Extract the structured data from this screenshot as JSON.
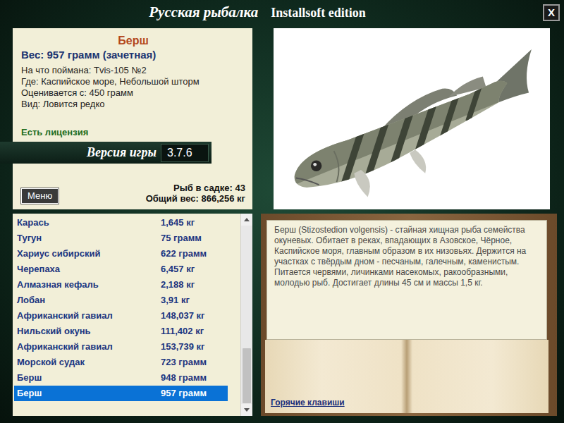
{
  "window": {
    "title": "Русская рыбалка",
    "subtitle": "Installsoft edition",
    "close": "X"
  },
  "catch": {
    "name": "Берш",
    "weight": "Вес: 957 грамм (зачетная)",
    "details": [
      "На что поймана: Tvis-105 №2",
      "Где: Каспийское море, Небольшой шторм",
      "Оценивается с: 450 грамм",
      "Вид: Ловится редко"
    ],
    "license": "Есть лицензия"
  },
  "version": {
    "label": "Версия игры",
    "value": "3.7.6"
  },
  "menu_button": "Меню",
  "keepnet": {
    "count": "Рыб в садке: 43",
    "total": "Общий вес: 866,256 кг"
  },
  "list": {
    "rows": [
      {
        "name": "Карась",
        "weight": "1,645 кг",
        "selected": false
      },
      {
        "name": "Тугун",
        "weight": "75 грамм",
        "selected": false
      },
      {
        "name": "Хариус сибирский",
        "weight": "622 грамм",
        "selected": false
      },
      {
        "name": "Черепаха",
        "weight": "6,457 кг",
        "selected": false
      },
      {
        "name": "Алмазная кефаль",
        "weight": "2,188 кг",
        "selected": false
      },
      {
        "name": "Лобан",
        "weight": "3,91 кг",
        "selected": false
      },
      {
        "name": "Африканский гавиал",
        "weight": "148,037 кг",
        "selected": false
      },
      {
        "name": "Нильский окунь",
        "weight": "111,402 кг",
        "selected": false
      },
      {
        "name": "Африканский гавиал",
        "weight": "153,739 кг",
        "selected": false
      },
      {
        "name": "Морской судак",
        "weight": "723 грамм",
        "selected": false
      },
      {
        "name": "Берш",
        "weight": "948 грамм",
        "selected": false
      },
      {
        "name": "Берш",
        "weight": "957 грамм",
        "selected": true
      }
    ],
    "scroll": {
      "level": 1
    }
  },
  "description": {
    "text": "Берш (Stizostedion volgensis) - стайная хищная рыба семейства окуневых. Обитает в реках, впадающих в Азовское, Чёрное, Каспийское моря, главным образом в их низовьях. Держится на участках с твёрдым дном - песчаным, галечным, каменистым. Питается червями, личинками насекомых, ракообразными, молодью рыб. Достигает длины 45 см и массы 1,5 кг.",
    "hotkeys": "Горячие клавиши"
  }
}
